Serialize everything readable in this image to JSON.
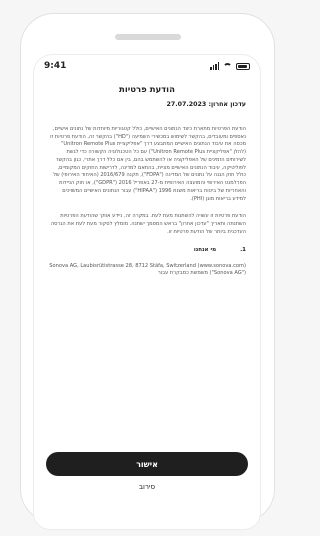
{
  "status_bar": {
    "time": "9:41",
    "icons": [
      "signal-icon",
      "wifi-icon",
      "battery-icon"
    ]
  },
  "header": {
    "title": "הודעת פרטיות",
    "updated": "עדכון אחרון: 27.07.2023"
  },
  "body": {
    "paragraph_1": "הודעת הפרטיות מתארת כיצד הנתונים האישיים, כולל קטגוריות מיוחדות של נתונים אישיים, נאספים ומעובדים, בהקשר לשימוש במכשירי השמיעה (\"HD\") בהקשר זה, הודעת פרטיות זו מכסה את עיבוד הנתונים האישיים המתבצע דרך \"אפליקציית Unitron Remote Plus\" (להלן \"אפליקציית Unitron Remote Plus\") עם כל הטכנולוגיה הקשורה כדי לגשת לשירותים הזמינים של האפליקציה או להשתמש בהם, בין אם כלל דרך אתרי, כגון בהקשר לפוליטיקה, עיבוד הנתונים האישיים מציית, בהתאם למדינה, לדרישות החוקים המקומיים, כולל חוק הגנה על נתונים של המדינה (\"FDPA\"), תקנה 2016/679 (האיחוד האירופי) של הפרלמנט האירופי והמועצה האירופית מ-27 באפריל 2016 (\"GDPR\"), או חוק הניידות והאחריות של ביטוח בריאות משנת 1996 (\"HIPAA\") עבור הנתונים האישיים המשויכים למידע בריאות מוגן (PHI).",
    "paragraph_2": "הודעת פרטיות זו עשויה להשתנות מעת לעת. במקרה זה, ניידע אותך שהודעת הפרטיות השתנתה ותאריך \"עדכון אחרון\" בראש המסמך ישתנה. מומלץ לסקור מעת לעת את הגרסה העדכנית ביותר של הודעת פרטיות זו.",
    "section_number": "1.",
    "section_title": "מי אנחנו",
    "address": "Sonova AG, Laubisrütistrasse 28, 8712 Stäfa, Switzerland (www.sonova.com) (\"Sonova AG\") משמשת כמבקרת עבור"
  },
  "actions": {
    "confirm_label": "אישור",
    "decline_label": "סירוב"
  }
}
